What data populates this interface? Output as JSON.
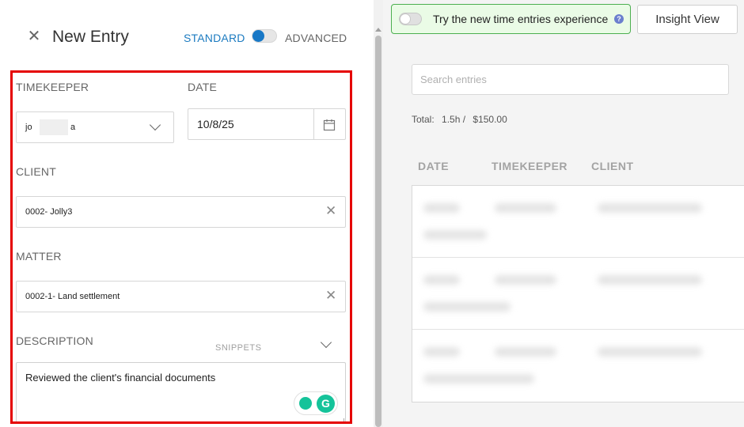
{
  "panel": {
    "title": "New Entry",
    "mode_standard": "STANDARD",
    "mode_advanced": "ADVANCED"
  },
  "form": {
    "timekeeper": {
      "label": "TIMEKEEPER",
      "value_start": "jo",
      "value_end": "a"
    },
    "date": {
      "label": "DATE",
      "value": "10/8/25"
    },
    "client": {
      "label": "CLIENT",
      "value": "0002- Jolly3"
    },
    "matter": {
      "label": "MATTER",
      "value": "0002-1- Land settlement"
    },
    "description": {
      "label": "DESCRIPTION",
      "snippets_label": "SNIPPETS",
      "value": "Reviewed the client's financial documents"
    }
  },
  "banner": {
    "text": "Try the new time entries experience",
    "help_glyph": "?"
  },
  "insight_button": "Insight View",
  "search": {
    "placeholder": "Search entries"
  },
  "totals": {
    "label": "Total:",
    "hours": "1.5h /",
    "amount": "$150.00"
  },
  "table": {
    "columns": [
      "DATE",
      "TIMEKEEPER",
      "CLIENT"
    ]
  },
  "colors": {
    "accent": "#1c7bc0",
    "highlight_border": "#e50000",
    "banner_bg": "#eafbe6",
    "banner_border": "#4caf50",
    "grammarly": "#15c39a"
  }
}
